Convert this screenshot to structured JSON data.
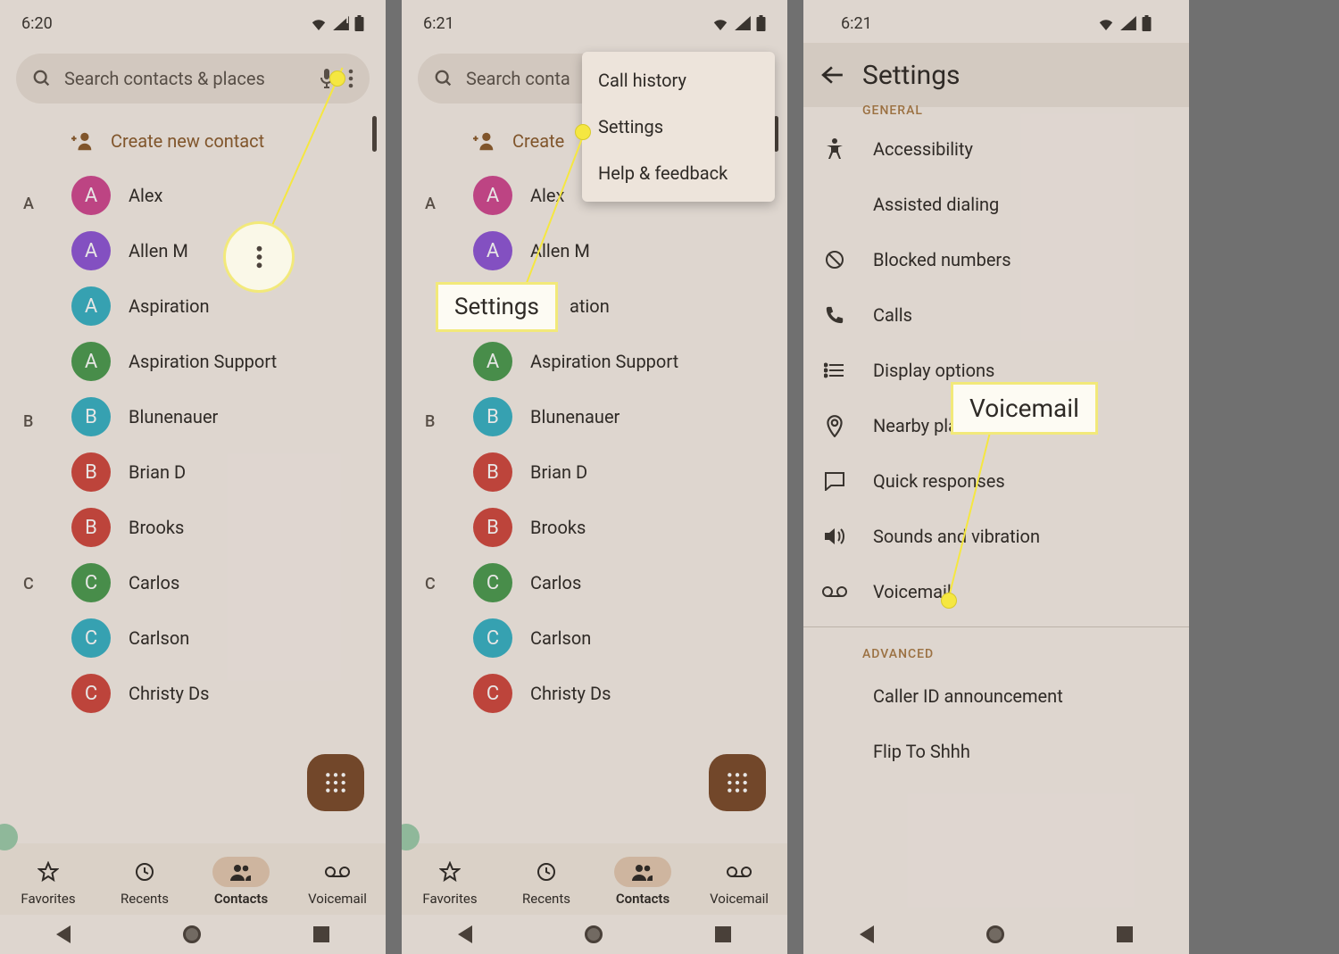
{
  "statusbar": {
    "time_p1": "6:20",
    "time_p2": "6:21",
    "time_p3": "6:21"
  },
  "search": {
    "placeholder": "Search contacts & places"
  },
  "create_contact": "Create new contact",
  "sections": {
    "A": [
      {
        "initial": "A",
        "name": "Alex",
        "color": "#d04790"
      },
      {
        "initial": "A",
        "name": "Allen M",
        "color": "#8e55d6"
      },
      {
        "initial": "A",
        "name": "Aspiration",
        "color": "#36b1c4"
      },
      {
        "initial": "A",
        "name": "Aspiration Support",
        "color": "#4a9a4f"
      }
    ],
    "B": [
      {
        "initial": "B",
        "name": "Blunenauer",
        "color": "#36b1c4"
      },
      {
        "initial": "B",
        "name": "Brian D",
        "color": "#d0473e"
      },
      {
        "initial": "B",
        "name": "Brooks",
        "color": "#d0473e"
      }
    ],
    "C": [
      {
        "initial": "C",
        "name": "Carlos",
        "color": "#4a9a4f"
      },
      {
        "initial": "C",
        "name": "Carlson",
        "color": "#36b1c4"
      },
      {
        "initial": "C",
        "name": "Christy Ds",
        "color": "#d0473e"
      }
    ]
  },
  "bottomnav": {
    "favorites": "Favorites",
    "recents": "Recents",
    "contacts": "Contacts",
    "voicemail": "Voicemail"
  },
  "popup": {
    "call_history": "Call history",
    "settings": "Settings",
    "help": "Help & feedback"
  },
  "settings_page": {
    "title": "Settings",
    "general": "GENERAL",
    "advanced": "ADVANCED",
    "items_general": {
      "accessibility": "Accessibility",
      "assisted": "Assisted dialing",
      "blocked": "Blocked numbers",
      "calls": "Calls",
      "display": "Display options",
      "nearby": "Nearby places",
      "quick": "Quick responses",
      "sounds": "Sounds and vibration",
      "voicemail": "Voicemail"
    },
    "items_advanced": {
      "callerid": "Caller ID announcement",
      "flip": "Flip To Shhh"
    }
  },
  "callouts": {
    "settings": "Settings",
    "voicemail": "Voicemail"
  }
}
